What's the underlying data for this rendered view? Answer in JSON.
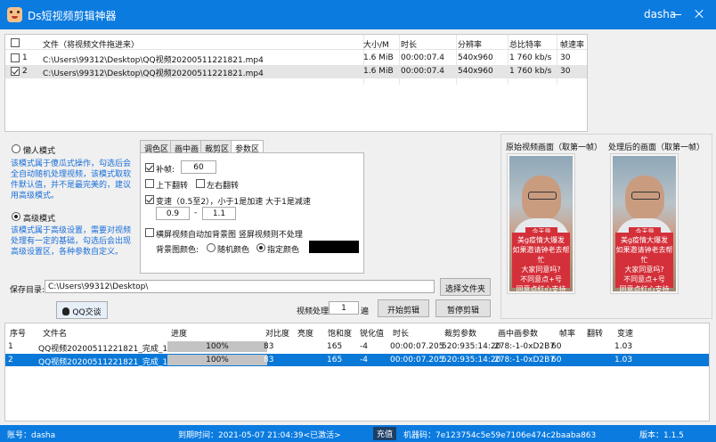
{
  "window": {
    "title": "Ds短视频剪辑神器",
    "user": "dasha"
  },
  "file_table": {
    "columns": [
      "文件（将视频文件拖进来）",
      "大小/M",
      "时长",
      "分辨率",
      "总比特率",
      "帧速率"
    ],
    "rows": [
      {
        "index": "1",
        "checked": false,
        "path": "C:\\Users\\99312\\Desktop\\QQ视频20200511221821.mp4",
        "size": "1.6 MiB",
        "duration": "00:00:07.4",
        "resolution": "540x960",
        "bitrate": "1 760 kb/s",
        "fps": "30"
      },
      {
        "index": "2",
        "checked": true,
        "path": "C:\\Users\\99312\\Desktop\\QQ视频20200511221821.mp4",
        "size": "1.6 MiB",
        "duration": "00:00:07.4",
        "resolution": "540x960",
        "bitrate": "1 760 kb/s",
        "fps": "30"
      }
    ]
  },
  "modes": {
    "lazy": {
      "label": "懒人模式",
      "desc": "该模式属于傻瓜式操作，勾选后会全自动随机处理视频，该模式取软件默认值，并不是最完美的，建议用高级模式。",
      "selected": false
    },
    "advanced": {
      "label": "高级模式",
      "desc": "该模式属于高级设置，需要对视频处理有一定的基础，勾选后会出现高级设置区，各种参数自定义。",
      "selected": true
    }
  },
  "tabs": [
    "调色区",
    "画中画",
    "裁剪区",
    "参数区"
  ],
  "params": {
    "fill_frames_label": "补帧:",
    "fill_frames_value": "60",
    "flip_vertical": "上下翻转",
    "flip_horizontal": "左右翻转",
    "speed_label": "变速（0.5至2），小于1是加速 大于1是减速",
    "speed_min": "0.9",
    "speed_sep": "-",
    "speed_max": "1.1",
    "landscape_label": "横屏视频自动加背景图 竖屏视频则不处理",
    "bg_color_label": "背景图颜色:",
    "bg_random": "随机颜色",
    "bg_custom": "指定颜色",
    "bg_color": "#000000"
  },
  "preview": {
    "original_label": "原始视频画面（取第一帧）",
    "processed_label": "处理后的画面（取第一帧）",
    "tag": "今天是6.11号",
    "caption": "美g疫情大爆发\n如果邀请钟老去帮忙\n大家同意吗?\n不同意点+号\n同意点红心支持"
  },
  "save": {
    "label": "保存目录:",
    "path": "C:\\Users\\99312\\Desktop\\",
    "choose_button": "选择文件夹"
  },
  "qq_button": "QQ交谈",
  "process": {
    "label": "视频处理",
    "count": "1",
    "unit": "遍",
    "start_button": "开始剪辑",
    "pause_button": "暂停剪辑"
  },
  "proc_table": {
    "columns": [
      "序号",
      "文件名",
      "进度",
      "对比度",
      "亮度",
      "饱和度",
      "锐化值",
      "时长",
      "裁剪参数",
      "画中画参数",
      "帧率",
      "翻转",
      "变速"
    ],
    "rows": [
      {
        "index": "1",
        "name": "QQ视频20200511221821_完成_1.mp4",
        "progress": "100%",
        "progress_value": 1.0,
        "contrast": "83",
        "brightness": "",
        "saturation": "165",
        "sharpen": "-4",
        "duration": "00:00:07.205",
        "crop": "520:935:14:20",
        "pip": "278:-1-0xD2B7",
        "fps": "60",
        "flip": "",
        "speed": "1.03",
        "selected": false
      },
      {
        "index": "2",
        "name": "QQ视频20200511221821_完成_1.mp4",
        "progress": "100%",
        "progress_value": 1.0,
        "contrast": "83",
        "brightness": "",
        "saturation": "165",
        "sharpen": "-4",
        "duration": "00:00:07.205",
        "crop": "520:935:14:20",
        "pip": "278:-1-0xD2B7",
        "fps": "60",
        "flip": "",
        "speed": "1.03",
        "selected": true
      }
    ]
  },
  "status": {
    "account_label": "账号：dasha",
    "expire": "到期时间：2021-05-07 21:04:39<已激活>",
    "activate_button": "充值",
    "machine": "机器码：7e123754c5e59e7106e474c2baaba863",
    "version": "版本：1.1.5"
  },
  "colors": {
    "accent": "#0b7be0",
    "selection": "#0a78d7",
    "description": "#1a6fd8"
  }
}
